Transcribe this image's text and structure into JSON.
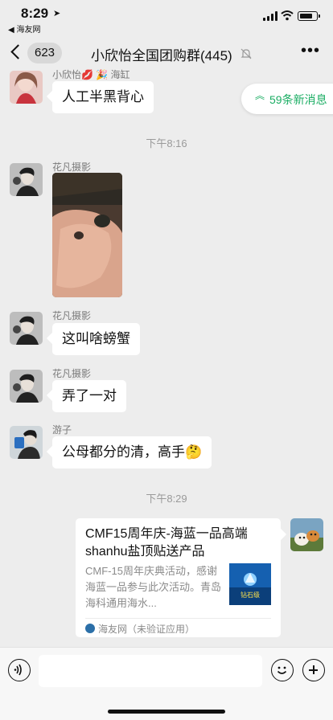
{
  "status_bar": {
    "time": "8:29",
    "back_app": "◀ 海友网"
  },
  "header": {
    "back_count": "623",
    "title": "小欣怡全国团购群(445)"
  },
  "new_messages": "59条新消息",
  "messages": [
    {
      "name": "小欣怡💋 🎉 海缸",
      "text": "人工半黑背心"
    },
    {
      "timestamp": "下午8:16"
    },
    {
      "name": "花凡摄影",
      "type": "image"
    },
    {
      "name": "花凡摄影",
      "text": "这叫啥螃蟹"
    },
    {
      "name": "花凡摄影",
      "text": "弄了一对"
    },
    {
      "name": "游子",
      "text": "公母都分的清，高手🤔"
    },
    {
      "timestamp": "下午8:29"
    }
  ],
  "link_card": {
    "title": "CMF15周年庆-海蓝一品高端shanhu盐顶贴送产品",
    "description": "CMF-15周年庆典活动，感谢海蓝一品参与此次活动。青岛海科通用海水...",
    "source": "海友网（未验证应用）",
    "thumb_text": "钻石级"
  },
  "icons": {
    "voice": "voice-icon",
    "emoji": "emoji-icon",
    "plus": "plus-icon",
    "mute": "mute-bell-icon",
    "more": "more-icon"
  },
  "colors": {
    "accent_green": "#1aad63",
    "background": "#ededed"
  }
}
